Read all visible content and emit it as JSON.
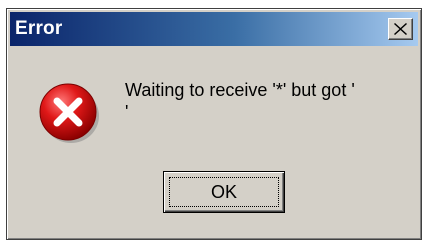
{
  "dialog": {
    "title": "Error",
    "close_icon": "close-x-icon",
    "icon": "error-icon",
    "message": "Waiting to receive '*' but got '\n'",
    "ok_label": "OK"
  },
  "colors": {
    "titlebar_start": "#0a246a",
    "titlebar_end": "#a6caf0",
    "dialog_bg": "#d4d0c8",
    "error_red": "#d21010"
  }
}
